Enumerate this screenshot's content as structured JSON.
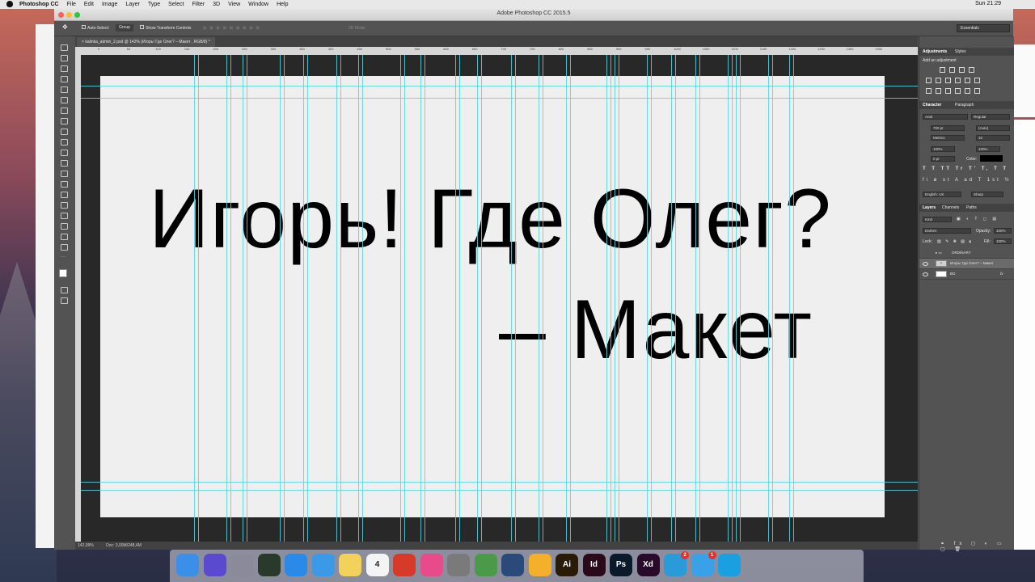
{
  "menubar": {
    "app_name": "Photoshop CC",
    "items": [
      "File",
      "Edit",
      "Image",
      "Layer",
      "Type",
      "Select",
      "Filter",
      "3D",
      "View",
      "Window",
      "Help"
    ],
    "clock": "Sun 21:29"
  },
  "window": {
    "title": "Adobe Photoshop CC 2015.5"
  },
  "options": {
    "auto_select_label": "Auto-Select:",
    "auto_select_value": "Group",
    "transform_label": "Show Transform Controls",
    "mode3d_label": "3D Mode:",
    "workspace": "Essentials"
  },
  "document": {
    "tab_label": "kalinka_admin_2.psd @ 142% (Игорь! Где Олег? – Макет , RGB/8) *",
    "line1": "Игорь! Где Олег?",
    "line2": "– Макет",
    "zoom": "142,09%",
    "doc_info": "Doc: 3,00M/248,4M"
  },
  "ruler": {
    "ticks": [
      "0",
      "50",
      "100",
      "150",
      "200",
      "250",
      "300",
      "350",
      "400",
      "450",
      "500",
      "550",
      "600",
      "650",
      "700",
      "750",
      "800",
      "850",
      "900",
      "950",
      "1000",
      "1050",
      "1100",
      "1150",
      "1200",
      "1250",
      "1300",
      "1350"
    ]
  },
  "panels": {
    "adjustments": {
      "tabs": [
        "Adjustments",
        "Styles"
      ],
      "subtitle": "Add an adjustment"
    },
    "character": {
      "tabs": [
        "Character",
        "Paragraph"
      ],
      "font_family": "Arial",
      "font_style": "Regular",
      "font_size": "700 pt",
      "leading": "(Auto)",
      "kerning": "Metrics",
      "tracking": "10",
      "vscale": "100%",
      "hscale": "100%",
      "baseline": "0 pt",
      "color_label": "Color:",
      "language": "English: UK",
      "antialias": "Sharp"
    },
    "layers": {
      "tabs": [
        "Layers",
        "Channels",
        "Paths"
      ],
      "kind": "Kind",
      "blend_mode": "Darken",
      "opacity_label": "Opacity:",
      "opacity": "100%",
      "lock_label": "Lock:",
      "fill_label": "Fill:",
      "fill": "100%",
      "items": [
        {
          "name": "ORDINARY",
          "type": "group"
        },
        {
          "name": "Игорь! Где Олег? – Макет",
          "type": "text"
        },
        {
          "name": "BG",
          "type": "raster"
        }
      ],
      "text_thumb": "T",
      "fx": "fx"
    }
  },
  "dock": {
    "apps": [
      {
        "name": "Finder",
        "color": "#3b8fe8",
        "glyph": ""
      },
      {
        "name": "Siri",
        "color": "#5a4ad0",
        "glyph": ""
      },
      {
        "name": "Launchpad",
        "color": "#8a8a9a",
        "glyph": ""
      },
      {
        "name": "Mission Control",
        "color": "#2a3a2a",
        "glyph": ""
      },
      {
        "name": "App Store",
        "color": "#2a8ae8",
        "glyph": ""
      },
      {
        "name": "Safari",
        "color": "#3a9ae8",
        "glyph": ""
      },
      {
        "name": "Notes",
        "color": "#f2d25a",
        "glyph": ""
      },
      {
        "name": "Calendar",
        "color": "#f4f4f4",
        "glyph": "4"
      },
      {
        "name": "Wunderlist",
        "color": "#d83a2a",
        "glyph": ""
      },
      {
        "name": "iTunes",
        "color": "#e84a8a",
        "glyph": ""
      },
      {
        "name": "System Preferences",
        "color": "#7a7a7a",
        "glyph": ""
      },
      {
        "name": "Chrome",
        "color": "#4a9a4a",
        "glyph": ""
      },
      {
        "name": "Nuclino",
        "color": "#2a4a7a",
        "glyph": ""
      },
      {
        "name": "Sketch",
        "color": "#f4b02a",
        "glyph": ""
      },
      {
        "name": "Illustrator",
        "color": "#2a1a08",
        "glyph": "Ai"
      },
      {
        "name": "InDesign",
        "color": "#2a0a1a",
        "glyph": "Id"
      },
      {
        "name": "Photoshop",
        "color": "#0a1a2a",
        "glyph": "Ps"
      },
      {
        "name": "Adobe XD",
        "color": "#2a0a2a",
        "glyph": "Xd"
      },
      {
        "name": "Telegram",
        "color": "#2a9ad8",
        "glyph": "",
        "badge": "2"
      },
      {
        "name": "Messages",
        "color": "#3aa0e8",
        "glyph": "",
        "badge": "1"
      },
      {
        "name": "Skype",
        "color": "#1aa0e0",
        "glyph": ""
      }
    ],
    "month": "DEC"
  }
}
